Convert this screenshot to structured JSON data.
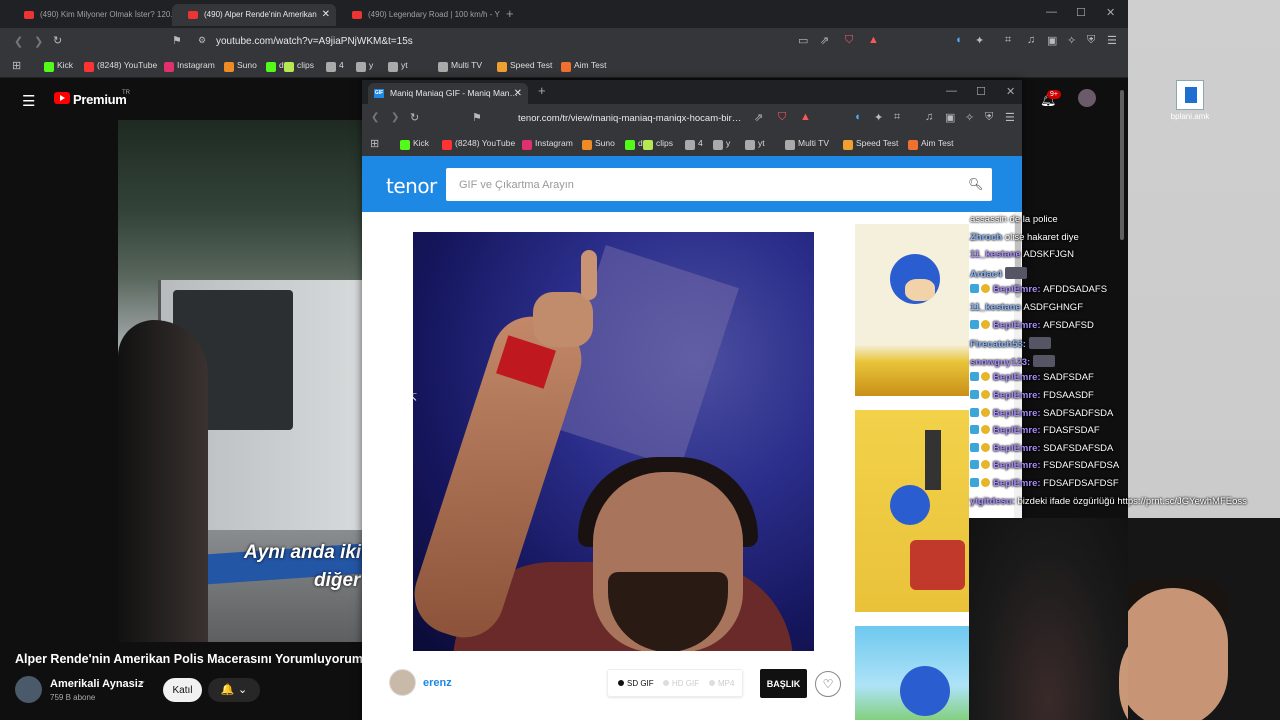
{
  "main_browser": {
    "tabs": [
      {
        "label": "(490) Kim Milyoner Olmak İster? 120…"
      },
      {
        "label": "(490) Alper Rende'nin Amerikan"
      },
      {
        "label": "(490) Legendary Road | 100 km/h - Y…"
      }
    ],
    "url": "youtube.com/watch?v=A9jiaPNjWKM&t=15s",
    "bookmarks": [
      "Kick",
      "(8248) YouTube",
      "Instagram",
      "Suno",
      "d",
      "clips",
      "4",
      "y",
      "yt",
      "Multi TV",
      "Speed Test",
      "Aim Test"
    ]
  },
  "youtube": {
    "brand": "Premium",
    "region": "TR",
    "notification_count": "9+",
    "subtitle_line1": "Aynı anda iki",
    "subtitle_line2": "diğer",
    "video_title": "Alper Rende'nin Amerikan Polis Macerasını Yorumluyorum",
    "channel_name": "Amerikali Aynasiz",
    "subscribers": "759 B abone",
    "join_label": "Katıl",
    "bell_label": "🔔 ⌄"
  },
  "tenor_browser": {
    "tab_label": "Maniq Maniaq GIF - Maniq Man…",
    "url": "tenor.com/tr/view/maniq-maniaq-maniqx-hocam-bir…",
    "bookmarks": [
      "Kick",
      "(8248) YouTube",
      "Instagram",
      "Suno",
      "d",
      "clips",
      "4",
      "y",
      "yt",
      "Multi TV",
      "Speed Test",
      "Aim Test"
    ]
  },
  "tenor": {
    "logo": "tenor",
    "search_placeholder": "GIF ve Çıkartma Arayın",
    "user": "erenz",
    "formats": [
      "SD GIF",
      "HD GIF",
      "MP4"
    ],
    "selected_format": "SD GIF",
    "title_button": "BAŞLIK"
  },
  "desktop_icon_label": "bplani.amk",
  "chat": [
    {
      "user": "",
      "text": "assassin de la police"
    },
    {
      "user": "Zhroch",
      "text": "olise hakaret diye"
    },
    {
      "user": "11_kestane",
      "text": "ADSKFJGN"
    },
    {
      "user": "Ardac4",
      "text": ""
    },
    {
      "user": "BeplEmre:",
      "text": "AFDDSADAFS"
    },
    {
      "user": "11_kestane",
      "text": "ASDFGHNGF"
    },
    {
      "user": "BeplEmre:",
      "text": "AFSDAFSD"
    },
    {
      "user": "Firecatch53:",
      "text": ""
    },
    {
      "user": "snowguy123:",
      "text": ""
    },
    {
      "user": "BeplEmre:",
      "text": "SADFSDAF"
    },
    {
      "user": "BeplEmre:",
      "text": "FDSAASDF"
    },
    {
      "user": "BeplEmre:",
      "text": "SADFSADFSDA"
    },
    {
      "user": "BeplEmre:",
      "text": "FDASFSDAF"
    },
    {
      "user": "BeplEmre:",
      "text": "SDAFSDAFSDA"
    },
    {
      "user": "BeplEmre:",
      "text": "FSDAFSDAFDSA"
    },
    {
      "user": "BeplEmre:",
      "text": "FDSAFDSAFDSF"
    },
    {
      "user": "yigitdesu:",
      "text": "bizdeki ifade özgürlüğü https://prnt.sc/JGYewhMFEoss"
    }
  ],
  "colors": {
    "tenor_blue": "#1e88e5",
    "youtube_red": "#ff0000",
    "chat_user_purple": "#a78bfa",
    "chat_user_blue": "#8ab4f8"
  }
}
